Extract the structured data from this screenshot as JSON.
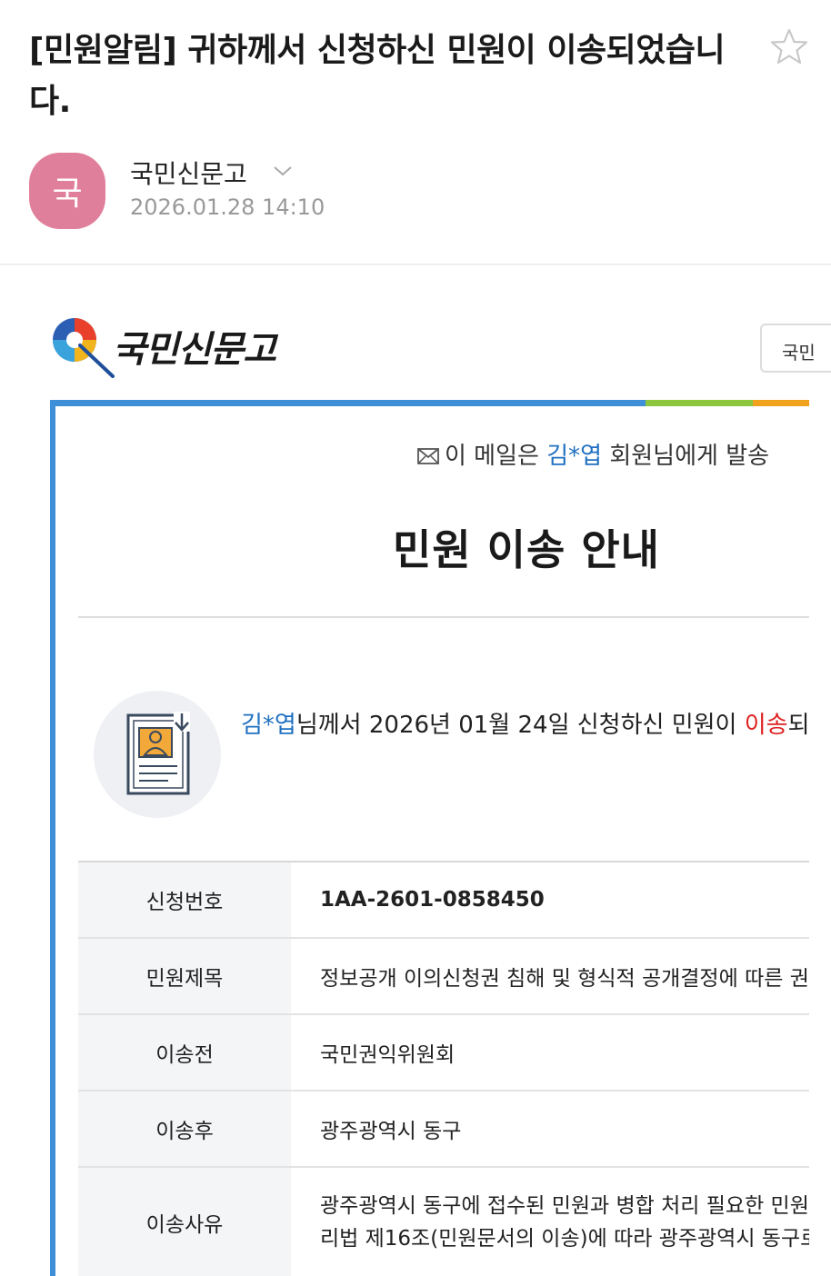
{
  "email": {
    "subject": "[민원알림] 귀하께서 신청하신 민원이 이송되었습니다.",
    "sender": {
      "avatar_letter": "국",
      "name": "국민신문고",
      "datetime": "2026.01.28 14:10"
    }
  },
  "body": {
    "logo_text": "국민신문고",
    "top_button_label": "국민",
    "notice": {
      "name": "김*엽",
      "prefix": "이 메일은 ",
      "suffix": " 회원님에게 발송"
    },
    "title": "민원 이송 안내",
    "intro": {
      "name": "김*엽",
      "text1": "님께서 2026년 01월 24일 신청하신 민원이 ",
      "highlight": "이송",
      "text2": "되"
    },
    "table": {
      "rows": [
        {
          "label": "신청번호",
          "value": "1AA-2601-0858450"
        },
        {
          "label": "민원제목",
          "value": "정보공개 이의신청권 침해 및 형식적 공개결정에 따른 권"
        },
        {
          "label": "이송전",
          "value": "국민권익위원회"
        },
        {
          "label": "이송후",
          "value": "광주광역시 동구"
        },
        {
          "label": "이송사유",
          "value_line1": "광주광역시 동구에 접수된 민원과 병합 처리 필요한 민원",
          "value_line2": "리법 제16조(민원문서의 이송)에 따라 광주광역시 동구로"
        }
      ]
    }
  },
  "colors": {
    "accent_blue": "#3f8fd8",
    "accent_green": "#8cc63f",
    "accent_orange": "#f0a21c",
    "link_blue": "#1f70c1",
    "highlight_red": "#e02020",
    "avatar_pink": "#e07f9b"
  },
  "icons": [
    "star-icon",
    "chevron-down-icon",
    "mail-icon",
    "document-person-icon",
    "logo-mark-icon"
  ]
}
